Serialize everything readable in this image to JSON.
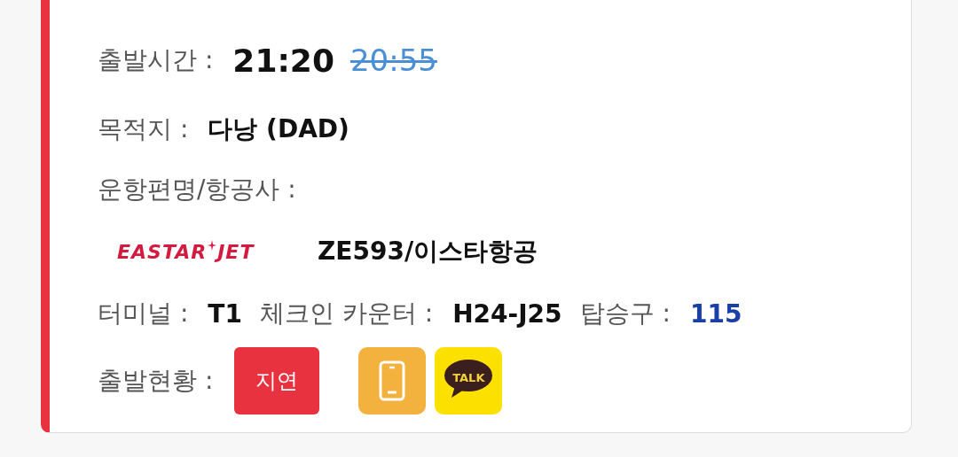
{
  "departure": {
    "label": "출발시간 :",
    "time": "21:20",
    "scheduled_time": "20:55"
  },
  "destination": {
    "label": "목적지 :",
    "value": "다낭 (DAD)"
  },
  "flight": {
    "label": "운항편명/항공사 :",
    "logo": {
      "left": "EASTAR",
      "right": "JET"
    },
    "value": "ZE593/이스타항공"
  },
  "info": [
    {
      "label": "터미널 :",
      "value": "T1",
      "kind": "plain"
    },
    {
      "label": "체크인 카운터 :",
      "value": "H24-J25",
      "kind": "plain"
    },
    {
      "label": "탑승구 :",
      "value": "115",
      "kind": "link"
    }
  ],
  "status": {
    "label": "출발현황 :",
    "badge": "지연",
    "kind": "delayed",
    "talk": "TALK"
  }
}
